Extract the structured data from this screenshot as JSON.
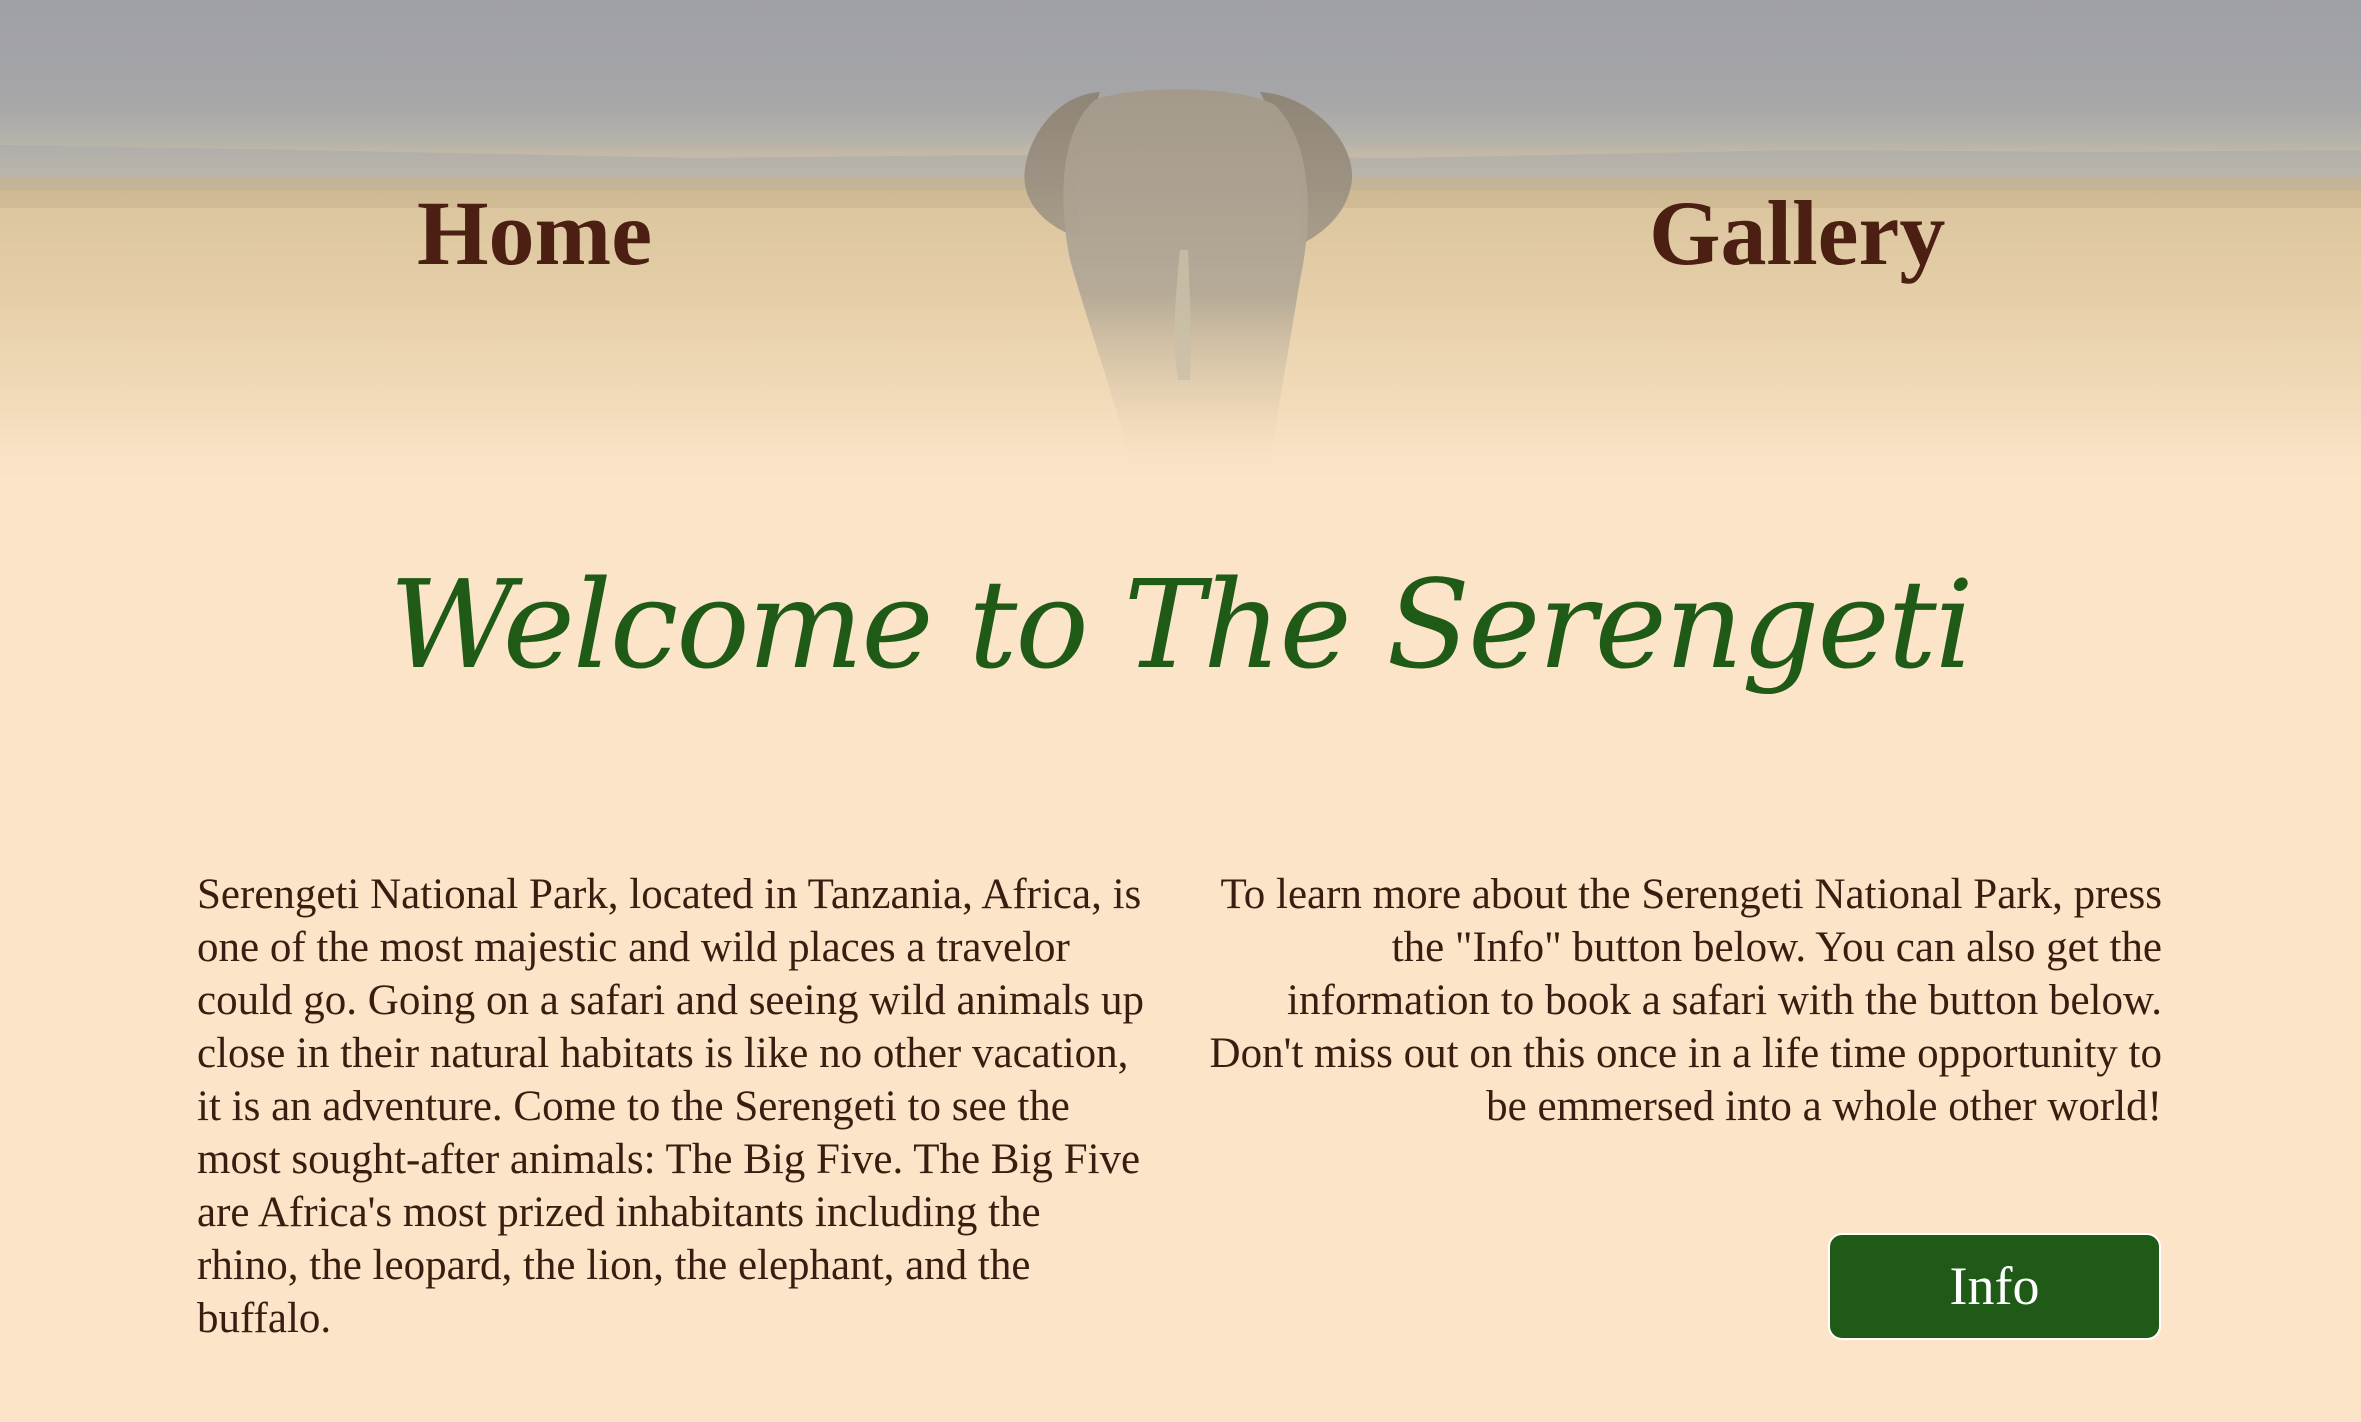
{
  "nav": {
    "home_label": "Home",
    "gallery_label": "Gallery"
  },
  "hero": {
    "image": "elephant-savanna-image"
  },
  "main": {
    "title": "Welcome to The Serengeti",
    "left_paragraph": "Serengeti National Park, located in Tanzania, Africa, is one of the most majestic and wild places a travelor could go. Going on a safari and seeing wild animals up close in their natural habitats is like no other vacation, it is an adventure. Come to the Serengeti to see the most sought-after animals: The Big Five. The Big Five are Africa's most prized inhabitants including the rhino, the leopard, the lion, the elephant, and the buffalo.",
    "right_paragraph": "To learn more about the Serengeti National Park, press the \"Info\" button below. You can also get the information to book a safari with the button below. Don't miss out on this once in a life time opportunity to be emmersed into a whole other world!",
    "info_button_label": "Info"
  },
  "colors": {
    "background": "#fbe4c8",
    "nav_text": "#4b2012",
    "title": "#1f5a17",
    "button": "#1f5a17",
    "body_text": "#3a1d10"
  }
}
